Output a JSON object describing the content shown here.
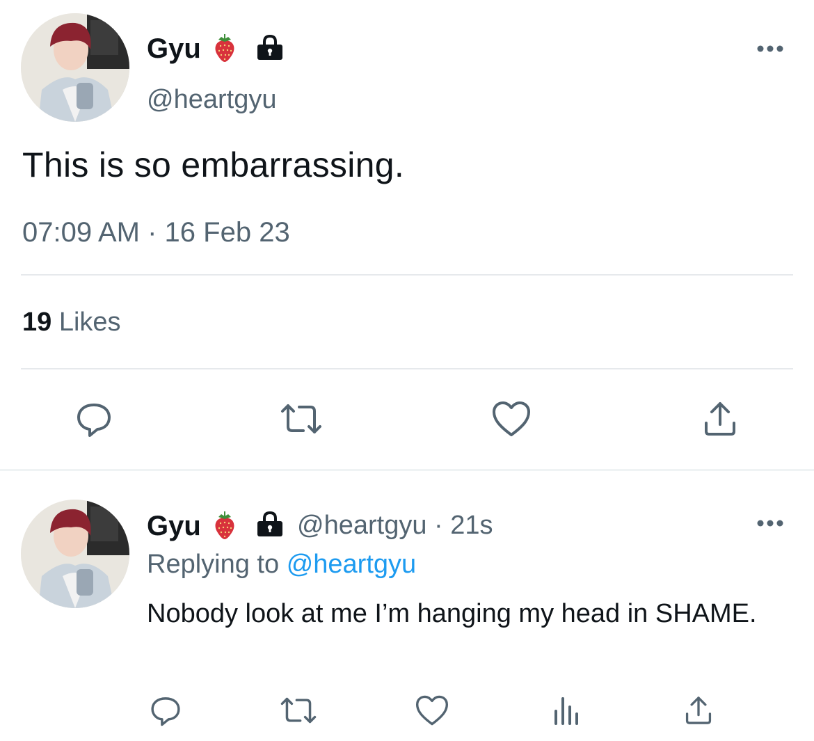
{
  "tweet": {
    "author_name": "Gyu",
    "author_handle": "@heartgyu",
    "text": "This is so embarrassing.",
    "timestamp": "07:09 AM · 16 Feb 23",
    "likes_count": "19",
    "likes_label": "Likes"
  },
  "reply": {
    "author_name": "Gyu",
    "author_handle": "@heartgyu",
    "separator": "·",
    "time_ago": "21s",
    "replying_prefix": "Replying to",
    "replying_mention": "@heartgyu",
    "text": "Nobody look at me I’m hanging my head in SHAME."
  },
  "icons": {
    "name_emoji": "strawberry-icon",
    "protected": "lock-icon",
    "more": "more-icon",
    "reply": "reply-icon",
    "retweet": "retweet-icon",
    "like": "heart-icon",
    "views": "views-icon",
    "share": "share-icon"
  },
  "colors": {
    "text_primary": "#0f1419",
    "text_secondary": "#536471",
    "link": "#1d9bf0",
    "divider": "#e6e9ec",
    "strawberry": "#d8323c"
  }
}
